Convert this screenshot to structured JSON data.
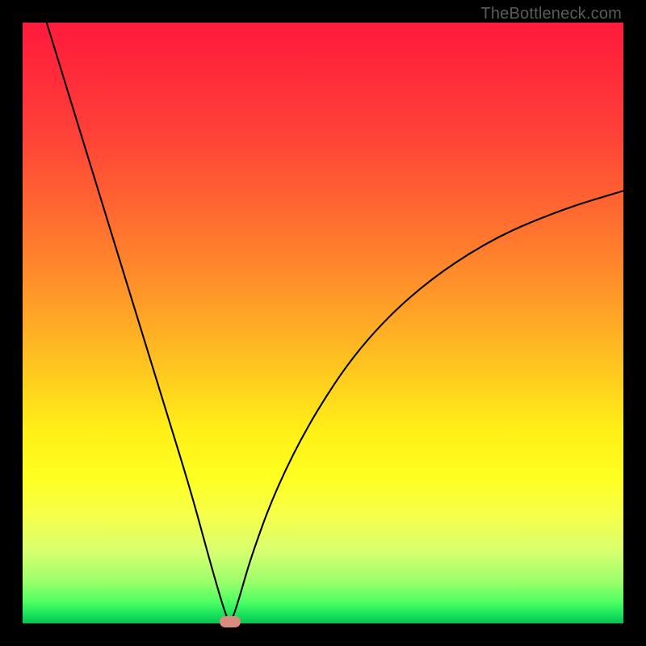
{
  "watermark": "TheBottleneck.com",
  "chart_data": {
    "type": "line",
    "title": "",
    "xlabel": "",
    "ylabel": "",
    "xlim": [
      0,
      100
    ],
    "ylim": [
      0,
      100
    ],
    "grid": false,
    "series": [
      {
        "name": "bottleneck-curve",
        "x": [
          4,
          8,
          12,
          16,
          20,
          24,
          28,
          31,
          33,
          34,
          34.5,
          35,
          36,
          38,
          42,
          48,
          56,
          66,
          78,
          90,
          100
        ],
        "y": [
          100,
          87,
          74,
          61,
          48,
          35,
          22,
          11,
          4,
          1,
          0,
          1,
          4,
          11,
          22,
          34,
          46,
          56,
          64,
          69,
          72
        ]
      }
    ],
    "annotations": [
      {
        "name": "optimal-marker",
        "x": 34.5,
        "y": 0,
        "color": "#da8b80"
      }
    ],
    "background_gradient": {
      "direction": "vertical",
      "stops": [
        {
          "pos": 0.0,
          "color": "#ff1b3c"
        },
        {
          "pos": 0.46,
          "color": "#ff9a28"
        },
        {
          "pos": 0.76,
          "color": "#ffff22"
        },
        {
          "pos": 1.0,
          "color": "#0cc050"
        }
      ]
    }
  }
}
